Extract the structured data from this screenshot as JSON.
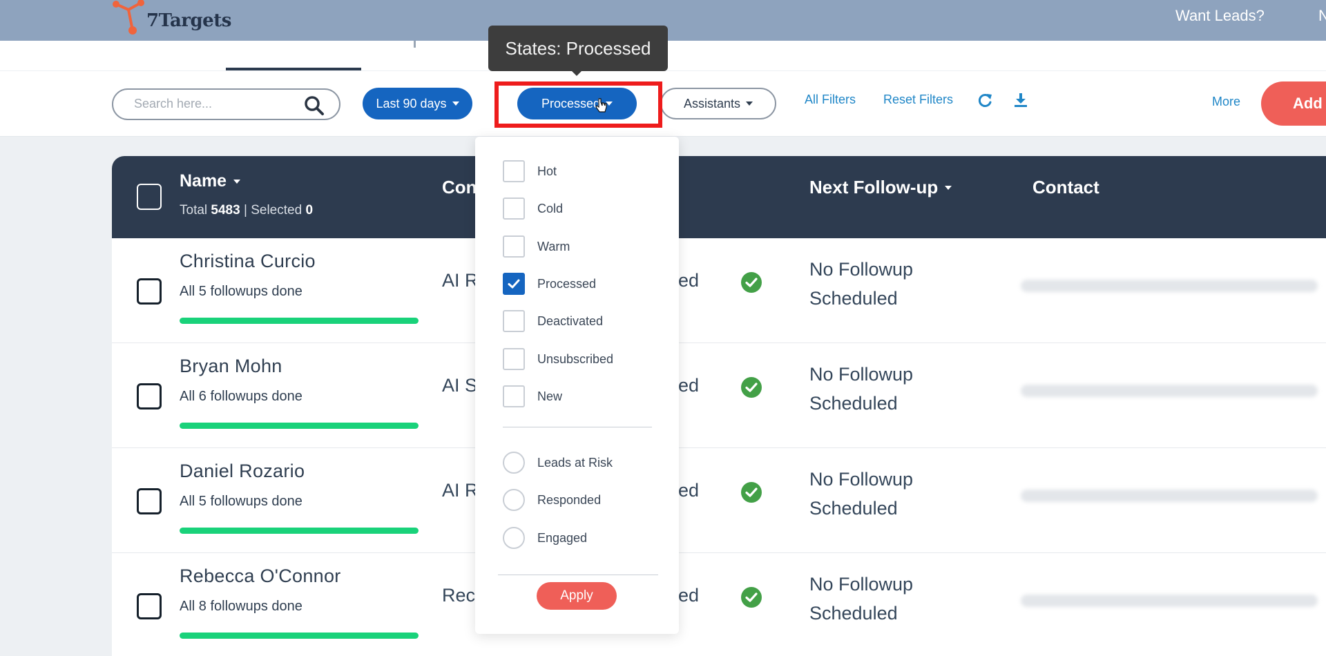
{
  "topbar": {
    "logo_text": "7Targets",
    "want_leads": "Want Leads?",
    "edge_text": "N"
  },
  "tooltip": {
    "text": "States: Processed"
  },
  "toolbar": {
    "search_placeholder": "Search here...",
    "date_filter": "Last 90 days",
    "state_filter": "Processed",
    "assistants_filter": "Assistants",
    "all_filters": "All Filters",
    "reset_filters": "Reset Filters",
    "more": "More",
    "add": "Add"
  },
  "table": {
    "header": {
      "name": "Name",
      "total_label": "Total",
      "total_value": "5483",
      "selected_label": "Selected",
      "selected_value": "0",
      "campaign": "Con",
      "next_followup": "Next Follow-up",
      "contact": "Contact"
    },
    "rows": [
      {
        "name": "Christina Curcio",
        "sub": "All 5 followups done",
        "campaign": "AI R",
        "state": "ed",
        "followup_line1": "No Followup",
        "followup_line2": "Scheduled",
        "progress": 1.0
      },
      {
        "name": "Bryan Mohn",
        "sub": "All 6 followups done",
        "campaign": "AI S",
        "state": "ed",
        "followup_line1": "No Followup",
        "followup_line2": "Scheduled",
        "progress": 1.0
      },
      {
        "name": "Daniel Rozario",
        "sub": "All 5 followups done",
        "campaign": "AI R",
        "state": "ed",
        "followup_line1": "No Followup",
        "followup_line2": "Scheduled",
        "progress": 1.0
      },
      {
        "name": "Rebecca O'Connor",
        "sub": "All 8 followups done",
        "campaign": "Rec",
        "state": "ed",
        "followup_line1": "No Followup",
        "followup_line2": "Scheduled",
        "progress": 1.0
      }
    ]
  },
  "dropdown": {
    "states": [
      {
        "label": "Hot",
        "checked": false
      },
      {
        "label": "Cold",
        "checked": false
      },
      {
        "label": "Warm",
        "checked": false
      },
      {
        "label": "Processed",
        "checked": true
      },
      {
        "label": "Deactivated",
        "checked": false
      },
      {
        "label": "Unsubscribed",
        "checked": false
      },
      {
        "label": "New",
        "checked": false
      }
    ],
    "options": [
      {
        "label": "Leads at Risk"
      },
      {
        "label": "Responded"
      },
      {
        "label": "Engaged"
      }
    ],
    "apply": "Apply"
  },
  "colors": {
    "topbar": "#8ea3be",
    "primary_blue": "#1565c0",
    "header_dark": "#2d3b4f",
    "accent_red": "#ef5f58",
    "progress_green": "#19d27a",
    "highlight_red": "#ee1c1c"
  }
}
